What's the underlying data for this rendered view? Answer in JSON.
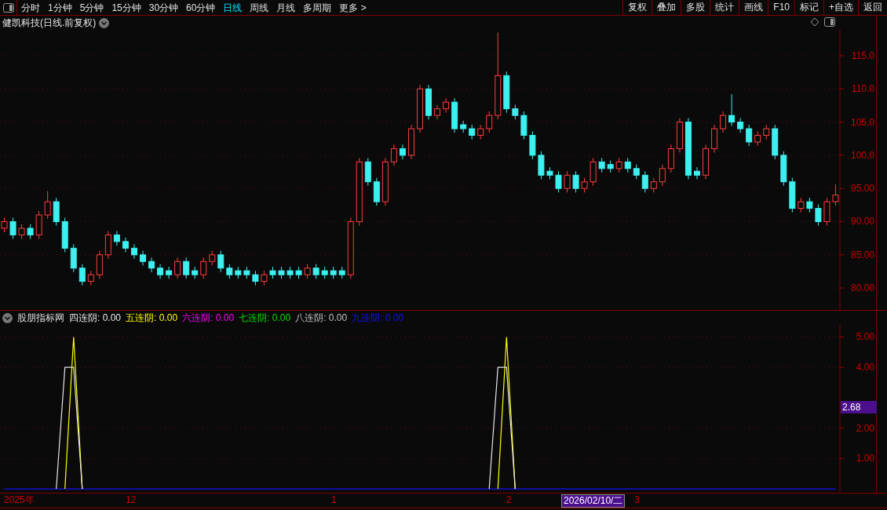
{
  "toolbar": {
    "periods": [
      {
        "label": "分时",
        "selected": false
      },
      {
        "label": "1分钟",
        "selected": false
      },
      {
        "label": "5分钟",
        "selected": false
      },
      {
        "label": "15分钟",
        "selected": false
      },
      {
        "label": "30分钟",
        "selected": false
      },
      {
        "label": "60分钟",
        "selected": false
      },
      {
        "label": "日线",
        "selected": true
      },
      {
        "label": "周线",
        "selected": false
      },
      {
        "label": "月线",
        "selected": false
      },
      {
        "label": "多周期",
        "selected": false
      }
    ],
    "more": "更多 >",
    "buttons": [
      "复权",
      "叠加",
      "多股",
      "统计",
      "画线",
      "F10",
      "标记",
      "+自选",
      "返回"
    ]
  },
  "main_chart": {
    "title": "健凯科技(日线.前复权)",
    "chart_data": {
      "type": "candlestick",
      "grid": true,
      "ylim": [
        76.7,
        118.9
      ],
      "yticks": [
        {
          "value": 115,
          "label": "115.0"
        },
        {
          "value": 110,
          "label": "110.0"
        },
        {
          "value": 105,
          "label": "105.0"
        },
        {
          "value": 100,
          "label": "100.0"
        },
        {
          "value": 95,
          "label": "95.00"
        },
        {
          "value": 90,
          "label": "90.00"
        },
        {
          "value": 85,
          "label": "85.00"
        },
        {
          "value": 80,
          "label": "80.00"
        }
      ],
      "ohlc": [
        [
          89,
          90.6,
          88.4,
          90
        ],
        [
          90,
          90.6,
          87.4,
          88
        ],
        [
          88,
          89.6,
          87.4,
          89
        ],
        [
          89,
          89.6,
          87.4,
          88
        ],
        [
          88,
          91.6,
          87.4,
          91
        ],
        [
          91,
          94.6,
          90.4,
          93
        ],
        [
          93,
          93.6,
          89.4,
          90
        ],
        [
          90,
          90.6,
          85.4,
          86
        ],
        [
          86,
          86.6,
          82.4,
          83
        ],
        [
          83,
          83.6,
          80.4,
          81
        ],
        [
          81,
          82.6,
          80.4,
          82
        ],
        [
          82,
          85.6,
          81.4,
          85
        ],
        [
          85,
          88.6,
          84.4,
          88
        ],
        [
          88,
          88.6,
          86.4,
          87
        ],
        [
          87,
          87.6,
          85.4,
          86
        ],
        [
          86,
          86.6,
          84.4,
          85
        ],
        [
          85,
          85.6,
          83.4,
          84
        ],
        [
          84,
          84.6,
          82.4,
          83
        ],
        [
          83,
          83.6,
          81.4,
          82
        ],
        [
          82.6,
          83.2,
          81.4,
          82
        ],
        [
          82,
          84.6,
          81.4,
          84
        ],
        [
          84,
          84.6,
          81.4,
          82
        ],
        [
          82.6,
          83.2,
          81.4,
          82
        ],
        [
          82,
          84.6,
          81.4,
          84
        ],
        [
          84,
          85.6,
          83.4,
          85
        ],
        [
          85,
          85.6,
          82.4,
          83
        ],
        [
          83,
          83.6,
          81.4,
          82
        ],
        [
          82.6,
          83.2,
          81.4,
          82
        ],
        [
          82.6,
          83.2,
          81.4,
          82
        ],
        [
          82,
          82.6,
          80.4,
          81
        ],
        [
          81,
          82.6,
          80.4,
          82
        ],
        [
          82.6,
          83.2,
          81.4,
          82
        ],
        [
          82.6,
          83.2,
          81.4,
          82
        ],
        [
          82.6,
          83.2,
          81.4,
          82
        ],
        [
          82.6,
          83.2,
          81.4,
          82
        ],
        [
          82,
          83.6,
          81.4,
          83
        ],
        [
          83,
          83.6,
          81.4,
          82
        ],
        [
          82.6,
          83.2,
          81.4,
          82
        ],
        [
          82.6,
          83.2,
          81.4,
          82
        ],
        [
          82.6,
          83.2,
          81.4,
          82
        ],
        [
          82,
          90.6,
          81.4,
          90
        ],
        [
          90,
          99.6,
          89.4,
          99
        ],
        [
          99,
          99.6,
          95.4,
          96
        ],
        [
          96,
          96.6,
          92.4,
          93
        ],
        [
          93,
          99.6,
          92.4,
          99
        ],
        [
          99,
          101.6,
          98.4,
          101
        ],
        [
          101,
          101.6,
          99.4,
          100
        ],
        [
          100,
          104.6,
          99.4,
          104
        ],
        [
          104,
          110.6,
          103.4,
          110
        ],
        [
          110,
          110.6,
          105.4,
          106
        ],
        [
          106,
          107.6,
          105.4,
          107
        ],
        [
          107,
          108.6,
          106.4,
          108
        ],
        [
          108,
          108.6,
          103.4,
          104
        ],
        [
          104.6,
          105.2,
          103.4,
          104
        ],
        [
          104,
          104.6,
          102.4,
          103
        ],
        [
          103,
          104.6,
          102.4,
          104
        ],
        [
          104,
          106.6,
          103.4,
          106
        ],
        [
          106,
          118.5,
          105.4,
          112
        ],
        [
          112,
          112.6,
          106.4,
          107
        ],
        [
          107,
          107.6,
          105.4,
          106
        ],
        [
          106,
          106.6,
          102.4,
          103
        ],
        [
          103,
          103.6,
          99.4,
          100
        ],
        [
          100,
          100.6,
          96.4,
          97
        ],
        [
          97.6,
          98.2,
          96.4,
          97
        ],
        [
          97,
          97.6,
          94.4,
          95
        ],
        [
          95,
          97.6,
          94.4,
          97
        ],
        [
          97,
          97.6,
          94.4,
          95
        ],
        [
          95,
          96.6,
          94.4,
          96
        ],
        [
          96,
          99.6,
          95.4,
          99
        ],
        [
          99,
          99.6,
          97.4,
          98
        ],
        [
          98.6,
          99.2,
          97.4,
          98
        ],
        [
          98,
          99.6,
          97.4,
          99
        ],
        [
          99,
          99.6,
          97.4,
          98
        ],
        [
          98,
          98.6,
          96.4,
          97
        ],
        [
          97,
          97.6,
          94.4,
          95
        ],
        [
          95,
          96.6,
          94.4,
          96
        ],
        [
          96,
          98.6,
          95.4,
          98
        ],
        [
          98,
          101.6,
          97.4,
          101
        ],
        [
          101,
          105.6,
          100.4,
          105
        ],
        [
          105,
          105.6,
          96.4,
          97
        ],
        [
          97.6,
          98.2,
          96.4,
          97
        ],
        [
          97,
          101.6,
          96.4,
          101
        ],
        [
          101,
          104.6,
          100.4,
          104
        ],
        [
          104,
          106.6,
          103.4,
          106
        ],
        [
          106,
          109.2,
          104.4,
          105
        ],
        [
          105,
          105.6,
          103.4,
          104
        ],
        [
          104,
          104.6,
          101.4,
          102
        ],
        [
          102,
          103.6,
          101.4,
          103
        ],
        [
          103,
          104.6,
          102.4,
          104
        ],
        [
          104,
          104.6,
          99.4,
          100
        ],
        [
          100,
          100.6,
          95.4,
          96
        ],
        [
          96,
          96.6,
          91.4,
          92
        ],
        [
          92,
          93.6,
          91.4,
          93
        ],
        [
          93,
          93.6,
          91.4,
          92
        ],
        [
          92,
          92.6,
          89.4,
          90
        ],
        [
          90,
          93.6,
          89.4,
          93
        ],
        [
          93,
          95.6,
          92.4,
          94
        ]
      ]
    }
  },
  "indicator": {
    "name": "股朋指标网",
    "legend_values": [
      ": 0.00",
      ": 0.00",
      ": 0.00",
      ": 0.00",
      ": 0.00",
      ": 0.00"
    ],
    "cursor_value": "2.68",
    "chart_data": {
      "type": "line",
      "grid": true,
      "ylim": [
        -0.1,
        5.4
      ],
      "yticks": [
        {
          "value": 1,
          "label": "1.00"
        },
        {
          "value": 2,
          "label": "2.00"
        },
        {
          "value": 4,
          "label": "4.00"
        },
        {
          "value": 5,
          "label": "5.00"
        }
      ],
      "series": [
        {
          "name": "四连阴",
          "color": "#e6e6e6",
          "values": [
            null,
            null,
            null,
            null,
            null,
            null,
            0,
            4,
            4,
            0,
            null,
            null,
            null,
            null,
            null,
            null,
            null,
            null,
            null,
            null,
            null,
            null,
            null,
            null,
            null,
            null,
            null,
            null,
            null,
            null,
            null,
            null,
            null,
            null,
            null,
            null,
            null,
            null,
            null,
            null,
            null,
            null,
            null,
            null,
            null,
            null,
            null,
            null,
            null,
            null,
            null,
            null,
            null,
            null,
            null,
            null,
            0,
            4,
            4,
            0,
            null,
            null,
            null,
            null,
            null,
            null,
            null,
            null,
            null,
            null,
            null,
            null,
            null,
            null,
            null,
            null,
            null,
            null,
            null,
            null,
            null,
            null,
            null,
            null,
            null,
            null,
            null,
            null,
            null,
            null,
            null,
            null,
            null,
            null,
            null,
            null,
            null
          ]
        },
        {
          "name": "五连阴",
          "color": "#ffff00",
          "values": [
            null,
            null,
            null,
            null,
            null,
            null,
            null,
            0,
            5,
            0,
            null,
            null,
            null,
            null,
            null,
            null,
            null,
            null,
            null,
            null,
            null,
            null,
            null,
            null,
            null,
            null,
            null,
            null,
            null,
            null,
            null,
            null,
            null,
            null,
            null,
            null,
            null,
            null,
            null,
            null,
            null,
            null,
            null,
            null,
            null,
            null,
            null,
            null,
            null,
            null,
            null,
            null,
            null,
            null,
            null,
            null,
            null,
            0,
            5,
            0,
            null,
            null,
            null,
            null,
            null,
            null,
            null,
            null,
            null,
            null,
            null,
            null,
            null,
            null,
            null,
            null,
            null,
            null,
            null,
            null,
            null,
            null,
            null,
            null,
            null,
            null,
            null,
            null,
            null,
            null,
            null,
            null,
            null,
            null,
            null,
            null,
            null
          ]
        },
        {
          "name": "六连阴",
          "color": "#ff00ff",
          "values": [
            null,
            null,
            null,
            null,
            null,
            null,
            null,
            null,
            null,
            null,
            null,
            null,
            null,
            null,
            null,
            null,
            null,
            null,
            null,
            null,
            null,
            null,
            null,
            null,
            null,
            null,
            null,
            null,
            null,
            null,
            null,
            null,
            null,
            null,
            null,
            null,
            null,
            null,
            null,
            null,
            null,
            null,
            null,
            null,
            null,
            null,
            null,
            null,
            null,
            null,
            null,
            null,
            null,
            null,
            null,
            null,
            null,
            null,
            null,
            null,
            null,
            null,
            null,
            null,
            null,
            null,
            null,
            null,
            null,
            null,
            null,
            null,
            null,
            null,
            null,
            null,
            null,
            null,
            null,
            null,
            null,
            null,
            null,
            null,
            null,
            null,
            null,
            null,
            null,
            null,
            null,
            null,
            null,
            null,
            null,
            null,
            null
          ]
        },
        {
          "name": "七连阴",
          "color": "#00e000",
          "values": [
            null,
            null,
            null,
            null,
            null,
            null,
            null,
            null,
            null,
            null,
            null,
            null,
            null,
            null,
            null,
            null,
            null,
            null,
            null,
            null,
            null,
            null,
            null,
            null,
            null,
            null,
            null,
            null,
            null,
            null,
            null,
            null,
            null,
            null,
            null,
            null,
            null,
            null,
            null,
            null,
            null,
            null,
            null,
            null,
            null,
            null,
            null,
            null,
            null,
            null,
            null,
            null,
            null,
            null,
            null,
            null,
            null,
            null,
            null,
            null,
            null,
            null,
            null,
            null,
            null,
            null,
            null,
            null,
            null,
            null,
            null,
            null,
            null,
            null,
            null,
            null,
            null,
            null,
            null,
            null,
            null,
            null,
            null,
            null,
            null,
            null,
            null,
            null,
            null,
            null,
            null,
            null,
            null,
            null,
            null,
            null,
            null
          ]
        },
        {
          "name": "八连阴",
          "color": "#c0c0c0",
          "values": [
            null,
            null,
            null,
            null,
            null,
            null,
            null,
            null,
            null,
            null,
            null,
            null,
            null,
            null,
            null,
            null,
            null,
            null,
            null,
            null,
            null,
            null,
            null,
            null,
            null,
            null,
            null,
            null,
            null,
            null,
            null,
            null,
            null,
            null,
            null,
            null,
            null,
            null,
            null,
            null,
            null,
            null,
            null,
            null,
            null,
            null,
            null,
            null,
            null,
            null,
            null,
            null,
            null,
            null,
            null,
            null,
            null,
            null,
            null,
            null,
            null,
            null,
            null,
            null,
            null,
            null,
            null,
            null,
            null,
            null,
            null,
            null,
            null,
            null,
            null,
            null,
            null,
            null,
            null,
            null,
            null,
            null,
            null,
            null,
            null,
            null,
            null,
            null,
            null,
            null,
            null,
            null,
            null,
            null,
            null,
            null,
            null
          ]
        },
        {
          "name": "九连阴",
          "color": "#1010ff",
          "values": [
            0,
            0,
            0,
            0,
            0,
            0,
            0,
            0,
            0,
            0,
            0,
            0,
            0,
            0,
            0,
            0,
            0,
            0,
            0,
            0,
            0,
            0,
            0,
            0,
            0,
            0,
            0,
            0,
            0,
            0,
            0,
            0,
            0,
            0,
            0,
            0,
            0,
            0,
            0,
            0,
            0,
            0,
            0,
            0,
            0,
            0,
            0,
            0,
            0,
            0,
            0,
            0,
            0,
            0,
            0,
            0,
            0,
            0,
            0,
            0,
            0,
            0,
            0,
            0,
            0,
            0,
            0,
            0,
            0,
            0,
            0,
            0,
            0,
            0,
            0,
            0,
            0,
            0,
            0,
            0,
            0,
            0,
            0,
            0,
            0,
            0,
            0,
            0,
            0,
            0,
            0,
            0,
            0,
            0,
            0,
            0,
            0
          ]
        }
      ]
    }
  },
  "date_axis": [
    {
      "label": "2025年",
      "kind": "tick"
    },
    {
      "label": "12",
      "kind": "tick"
    },
    {
      "label": "1",
      "kind": "tick"
    },
    {
      "label": "2",
      "kind": "tick"
    },
    {
      "label": "2026/02/10/二",
      "kind": "cursor"
    },
    {
      "label": "3",
      "kind": "tick"
    }
  ]
}
